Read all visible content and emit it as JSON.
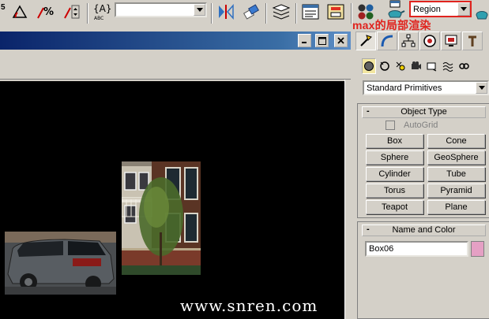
{
  "toolbar": {
    "left_fragment": "5",
    "selection_set_value": "",
    "snap_label": "ABC",
    "render_type": "Region"
  },
  "annotation": "max的局部渲染",
  "watermark": "www.snren.com",
  "command_panel": {
    "dropdown_value": "Standard Primitives",
    "object_type": {
      "title": "Object Type",
      "collapse_symbol": "-",
      "autogrid_label": "AutoGrid",
      "buttons": [
        "Box",
        "Cone",
        "Sphere",
        "GeoSphere",
        "Cylinder",
        "Tube",
        "Torus",
        "Pyramid",
        "Teapot",
        "Plane"
      ]
    },
    "name_and_color": {
      "title": "Name and Color",
      "collapse_symbol": "-",
      "name_value": "Box06",
      "color": "#e5a0c4"
    }
  },
  "colors": {
    "accent_red": "#e0231e",
    "titlebar_blue": "#0a246a",
    "ui_gray": "#d4d0c8",
    "viewport_bg": "#000000"
  }
}
